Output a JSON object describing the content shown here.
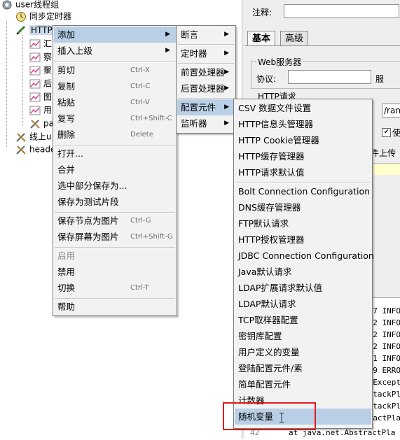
{
  "tree": {
    "nodes": [
      {
        "label": "user线程组",
        "icon": "gear-icon"
      },
      {
        "label": "同步定时器",
        "icon": "timer-icon"
      },
      {
        "label": "HTTP",
        "icon": "pen-icon",
        "selected": true
      },
      {
        "label": "汇",
        "icon": "graph-icon"
      },
      {
        "label": "察",
        "icon": "graph-icon"
      },
      {
        "label": "聚",
        "icon": "graph-icon"
      },
      {
        "label": "后",
        "icon": "graph-icon"
      },
      {
        "label": "图",
        "icon": "graph-icon"
      },
      {
        "label": "用",
        "icon": "graph-icon"
      },
      {
        "label": "pa",
        "icon": "tools-icon"
      },
      {
        "label": "线上u",
        "icon": "tools-icon"
      },
      {
        "label": "heade",
        "icon": "tools-icon"
      }
    ]
  },
  "right_panel": {
    "comment_label": "注释:",
    "tabs": [
      "基本",
      "高级"
    ],
    "web_server_label": "Web服务器",
    "protocol_label": "协议:",
    "protocol_value": "",
    "http_request_label": "HTTP请求",
    "path_value": "/ran",
    "upload_label": "件上传",
    "log_prefixes": [
      "7 INFO",
      "2 INFO",
      "2 INFO",
      "2 INFO",
      "1 INFO",
      "9 ERRO",
      "Except",
      "tackPl",
      "tackPl",
      "actPla"
    ],
    "bottom_line_number": "42",
    "bottom_line_text": "at java.net.AbstractPla"
  },
  "context_menu": {
    "items": [
      {
        "label": "添加",
        "submenu": true,
        "selected": true
      },
      {
        "label": "插入上级",
        "submenu": true
      },
      {
        "sep": true
      },
      {
        "label": "剪切",
        "shortcut": "Ctrl-X"
      },
      {
        "label": "复制",
        "shortcut": "Ctrl-C"
      },
      {
        "label": "粘贴",
        "shortcut": "Ctrl-V"
      },
      {
        "label": "复写",
        "shortcut": "Ctrl+Shift-C"
      },
      {
        "label": "删除",
        "shortcut": "Delete"
      },
      {
        "sep": true
      },
      {
        "label": "打开..."
      },
      {
        "label": "合并"
      },
      {
        "label": "选中部分保存为..."
      },
      {
        "label": "保存为测试片段"
      },
      {
        "sep": true
      },
      {
        "label": "保存节点为图片",
        "shortcut": "Ctrl-G"
      },
      {
        "label": "保存屏幕为图片",
        "shortcut": "Ctrl+Shift-G"
      },
      {
        "sep": true
      },
      {
        "label": "启用",
        "disabled": true
      },
      {
        "label": "禁用"
      },
      {
        "label": "切换",
        "shortcut": "Ctrl-T"
      },
      {
        "sep": true
      },
      {
        "label": "帮助"
      }
    ]
  },
  "add_submenu": {
    "items": [
      {
        "label": "断言",
        "submenu": true
      },
      {
        "label": "定时器",
        "submenu": true
      },
      {
        "label": "前置处理器",
        "submenu": true
      },
      {
        "label": "后置处理器",
        "submenu": true
      },
      {
        "label": "配置元件",
        "submenu": true,
        "selected": true
      },
      {
        "label": "监听器",
        "submenu": true
      }
    ]
  },
  "config_submenu": {
    "items": [
      {
        "label": "CSV 数据文件设置"
      },
      {
        "label": "HTTP信息头管理器"
      },
      {
        "label": "HTTP Cookie管理器"
      },
      {
        "label": "HTTP缓存管理器"
      },
      {
        "label": "HTTP请求默认值"
      },
      {
        "sep": true
      },
      {
        "label": "Bolt Connection Configuration"
      },
      {
        "label": "DNS缓存管理器"
      },
      {
        "label": "FTP默认请求"
      },
      {
        "label": "HTTP授权管理器"
      },
      {
        "label": "JDBC Connection Configuration"
      },
      {
        "label": "Java默认请求"
      },
      {
        "label": "LDAP扩展请求默认值"
      },
      {
        "label": "LDAP默认请求"
      },
      {
        "label": "TCP取样器配置"
      },
      {
        "label": "密钥库配置"
      },
      {
        "label": "用户定义的变量"
      },
      {
        "label": "登陆配置元件/素"
      },
      {
        "label": "简单配置元件"
      },
      {
        "label": "计数器"
      },
      {
        "label": "随机变量",
        "selected": true
      }
    ]
  },
  "colors": {
    "menu_bg": "#f2f2f2",
    "menu_selected": "#b8cfe5",
    "highlight_box": "#e21b1b"
  }
}
